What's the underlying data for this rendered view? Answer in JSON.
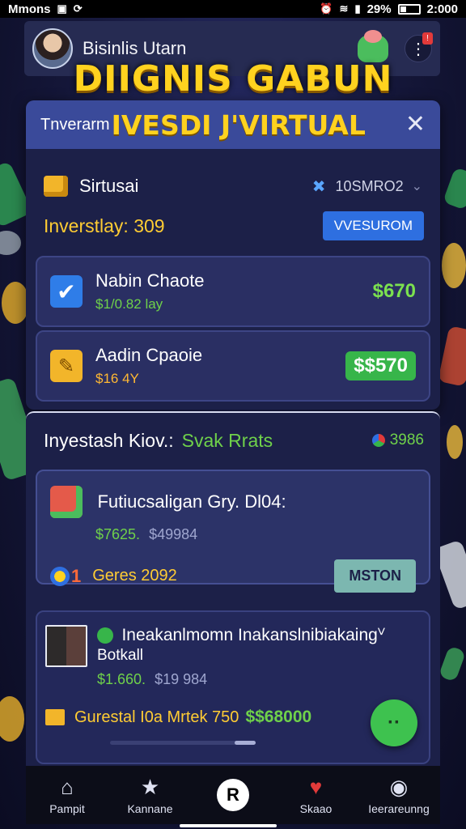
{
  "status_bar": {
    "carrier": "Mmons",
    "battery": "29%",
    "time": "2:000"
  },
  "header": {
    "username": "Bisinlis Utarn",
    "headline": "DIIGNIS GABUN",
    "notification_badge": "!"
  },
  "modal": {
    "title_small": "Tnverarm",
    "title_big": "IVESDI J'VIRTUAL",
    "close_label": "✕",
    "category_label": "Sirtusai",
    "category_code": "10SMRO2",
    "investday_label": "Inverstlay: 309",
    "action_button": "VVESUROM",
    "items": [
      {
        "title": "Nabin Chaote",
        "subtitle": "$1/0.82 lay",
        "price": "$670"
      },
      {
        "title": "Aadin Cpaoie",
        "subtitle": "$16 4Y",
        "price": "$$570"
      }
    ]
  },
  "panel2": {
    "title": "Inyestash Kiov.:",
    "title_highlight": "Svak Rrats",
    "title_value": "3986",
    "feature_card": {
      "title": "Futiucsaligan Gry. Dl04:",
      "amount": "$7625.",
      "amount_secondary": "$49984",
      "rank": "1",
      "label": "Geres 2092",
      "button": "MSTON"
    },
    "list_card": {
      "name": "Ineakanlmomn Inakanslnibiakaingⱽ",
      "name_line2": "Botkall",
      "amount": "$1.660.",
      "amount_secondary": "$19 984",
      "footer_label": "Gurestal I0a Mrtek 750",
      "footer_value": "$$68000"
    },
    "fab_label": "··"
  },
  "bottom_nav": [
    {
      "label": "Pampit",
      "icon": "home-icon"
    },
    {
      "label": "Kannane",
      "icon": "star-icon"
    },
    {
      "label": "R",
      "icon": "center-action-icon"
    },
    {
      "label": "Skaao",
      "icon": "heart-icon"
    },
    {
      "label": "Ieerareunng",
      "icon": "profile-icon"
    }
  ],
  "colors": {
    "accent_gold": "#ffd21f",
    "accent_green": "#6fd14a",
    "accent_blue": "#2e6fe0",
    "panel_bg": "#1c2048"
  }
}
